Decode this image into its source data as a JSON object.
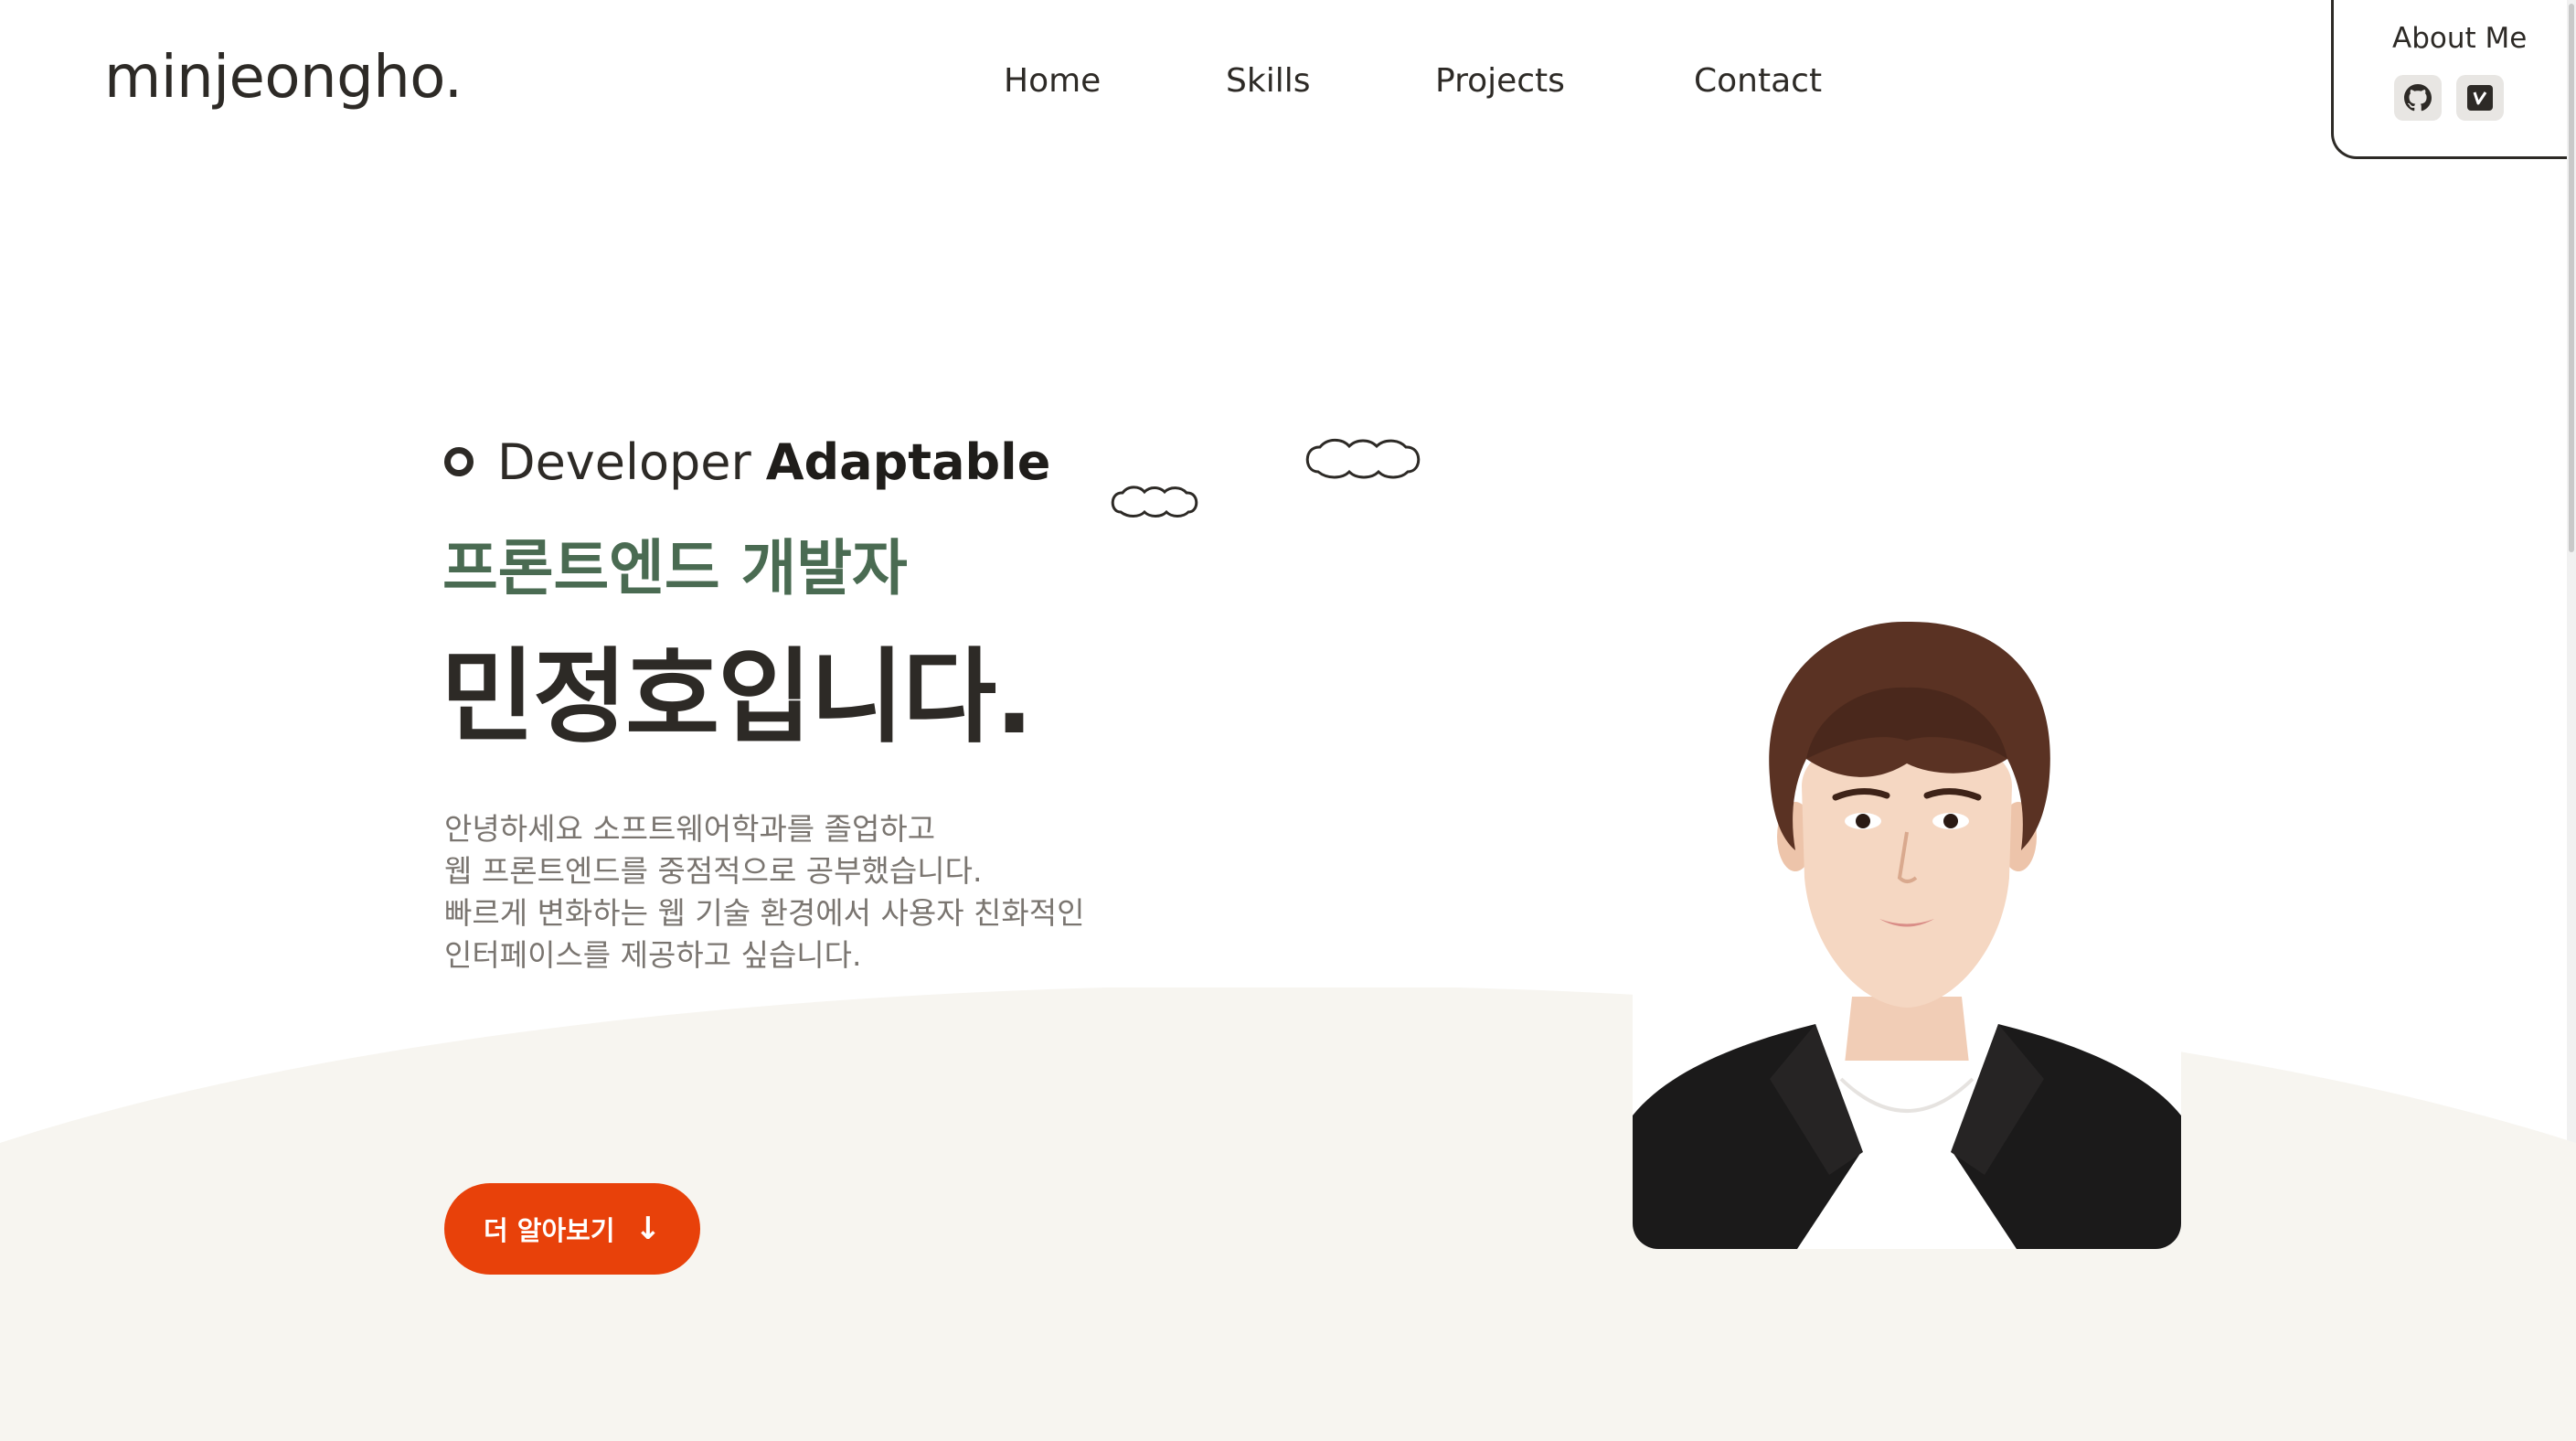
{
  "header": {
    "logo": "minjeongho.",
    "nav": [
      {
        "label": "Home"
      },
      {
        "label": "Skills"
      },
      {
        "label": "Projects"
      },
      {
        "label": "Contact"
      }
    ],
    "about": {
      "title": "About Me",
      "icons": [
        "github-icon",
        "velog-icon"
      ]
    }
  },
  "hero": {
    "tagline_prefix": "Developer",
    "tagline_strong": "Adaptable",
    "role": "프론트엔드 개발자",
    "name": "민정호입니다.",
    "description": [
      "안녕하세요 소프트웨어학과를 졸업하고",
      "웹 프론트엔드를 중점적으로 공부했습니다.",
      "빠르게 변화하는 웹 기술 환경에서 사용자 친화적인",
      "인터페이스를 제공하고 싶습니다."
    ],
    "cta_label": "더 알아보기",
    "cta_icon": "arrow-down-icon"
  },
  "colors": {
    "accent": "#e8410a",
    "role_green": "#4a6b52",
    "text_dark": "#2d2a26",
    "wave_beige": "#f7f5f0"
  }
}
